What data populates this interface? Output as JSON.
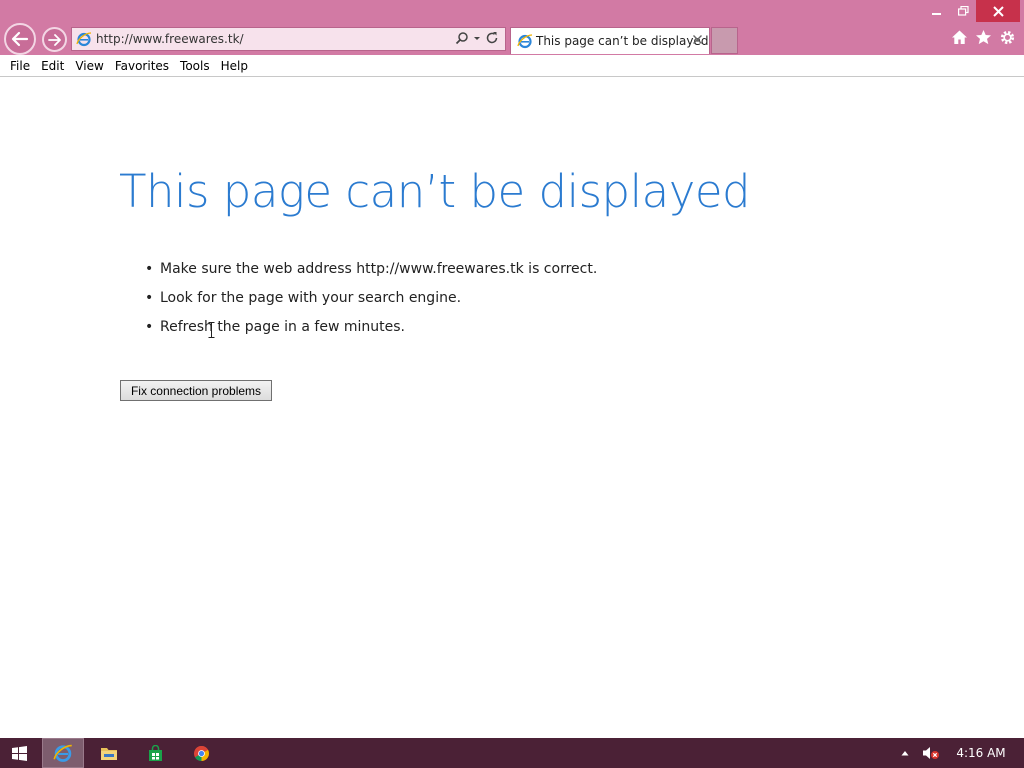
{
  "browser": {
    "address": "http://www.freewares.tk/",
    "tab_title": "This page can’t be displayed",
    "icons": [
      "back-arrow-icon",
      "forward-arrow-icon",
      "ie-logo-icon",
      "search-icon",
      "dropdown-icon",
      "refresh-icon",
      "close-icon",
      "home-icon",
      "favorites-star-icon",
      "settings-gear-icon"
    ],
    "colors": {
      "chrome": "#d27aa4",
      "close": "#c7314b",
      "accent": "#2b7bd0"
    }
  },
  "menu": {
    "items": [
      "File",
      "Edit",
      "View",
      "Favorites",
      "Tools",
      "Help"
    ]
  },
  "page": {
    "title": "This page can’t be displayed",
    "suggestions": [
      "Make sure the web address http://www.freewares.tk is correct.",
      "Look for the page with your search engine.",
      "Refresh the page in a few minutes."
    ],
    "fix_button": "Fix connection problems"
  },
  "taskbar": {
    "time": "4:16 AM",
    "icons": [
      "windows-start-icon",
      "internet-explorer-icon",
      "file-explorer-icon",
      "store-icon",
      "chrome-icon",
      "tray-arrow-icon",
      "volume-muted-icon"
    ],
    "color": "#4b2136"
  }
}
